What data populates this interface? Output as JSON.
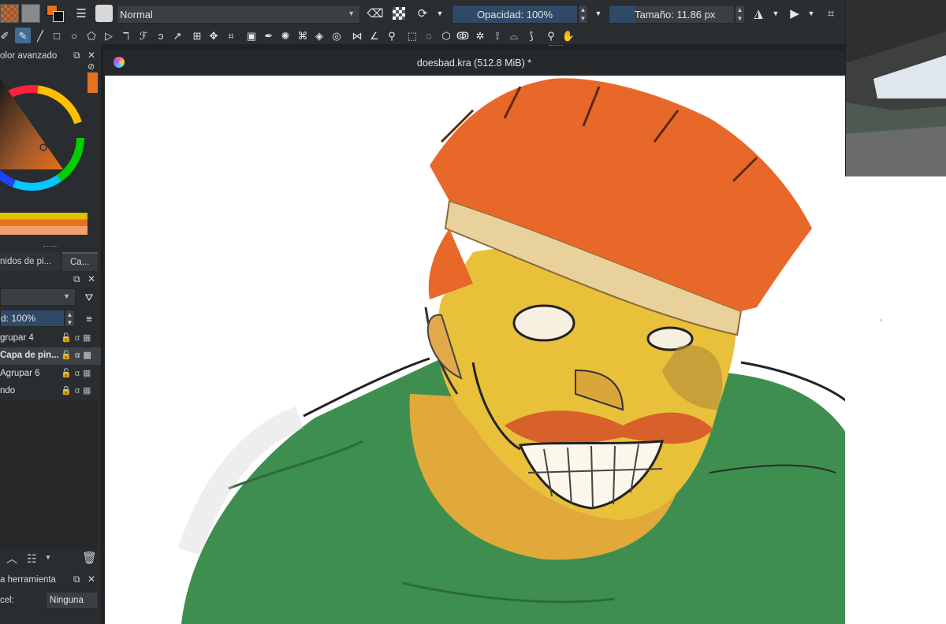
{
  "toolbar": {
    "blend_mode": "Normal",
    "opacity": "Opacidad: 100%",
    "size": "Tamaño: 11.86 px",
    "brush_color": "#e8701e",
    "icons": [
      "pattern-icon",
      "gradient-icon",
      "color-swap-icon",
      "brush-settings-icon",
      "brush-preset-icon",
      "eraser-icon",
      "alpha-lock-icon",
      "reload-icon",
      "mirror-horizontal-icon",
      "mirror-vertical-icon",
      "wrap-icon"
    ]
  },
  "tools": [
    "freehand-path",
    "brush",
    "line",
    "rectangle",
    "ellipse",
    "polygon",
    "polyline",
    "bezier",
    "freehand-calligraphy",
    "dynamic-brush",
    "multibrush",
    "transform",
    "move",
    "crop",
    "gradient",
    "color-picker",
    "smart-patch",
    "fill",
    "enclose-fill",
    "assistant",
    "measure",
    "reference-images",
    "rectangle-select",
    "ellipse-select",
    "polygon-select",
    "freehand-select",
    "contiguous-select",
    "similar-select",
    "bezier-select",
    "magnetic-select",
    "zoom",
    "pan"
  ],
  "color_docker": {
    "title": "olor avanzado",
    "accent": "#e8701e"
  },
  "layers_docker": {
    "tabs": [
      "nidos de pi...",
      "Ca..."
    ],
    "opacity": "d:  100%",
    "layers": [
      {
        "name": "grupar 4",
        "selected": false
      },
      {
        "name": "Capa de pin...",
        "selected": true
      },
      {
        "name": "Agrupar 6",
        "selected": false
      },
      {
        "name": "ndo",
        "selected": false
      }
    ]
  },
  "tool_options": {
    "title": "a herramienta",
    "label": "cel:",
    "value": "Ninguna"
  },
  "document": {
    "title": "doesbad.kra (512.8 MiB) *"
  },
  "colors": {
    "hair": "#e8682a",
    "skin": "#e9c03a",
    "shirt": "#3e8f4f",
    "headband": "#e8d19a"
  }
}
